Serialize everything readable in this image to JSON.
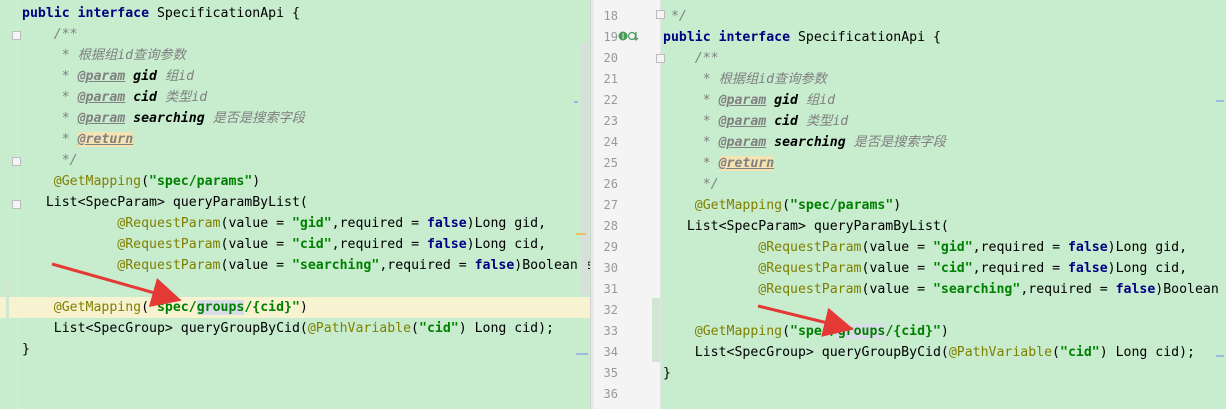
{
  "left": {
    "lines": [
      [
        [
          "kw",
          "public interface "
        ],
        [
          "",
          "SpecificationApi {"
        ]
      ],
      [
        [
          "cm",
          "    /**"
        ]
      ],
      [
        [
          "cm",
          "     * 根据组id查询参数"
        ]
      ],
      [
        [
          "cm",
          "     * "
        ],
        [
          "tag",
          "@param"
        ],
        [
          "cm",
          " "
        ],
        [
          "cmb",
          "gid"
        ],
        [
          "cm",
          " 组id"
        ]
      ],
      [
        [
          "cm",
          "     * "
        ],
        [
          "tag",
          "@param"
        ],
        [
          "cm",
          " "
        ],
        [
          "cmb",
          "cid"
        ],
        [
          "cm",
          " 类型id"
        ]
      ],
      [
        [
          "cm",
          "     * "
        ],
        [
          "tag",
          "@param"
        ],
        [
          "cm",
          " "
        ],
        [
          "cmb",
          "searching"
        ],
        [
          "cm",
          " 是否是搜索字段"
        ]
      ],
      [
        [
          "cm",
          "     * "
        ],
        [
          "ret",
          "@return"
        ]
      ],
      [
        [
          "cm",
          "     */"
        ]
      ],
      [
        [
          "ann",
          "    @GetMapping"
        ],
        [
          "",
          "("
        ],
        [
          "str",
          "\"spec/params\""
        ],
        [
          "",
          ")"
        ]
      ],
      [
        [
          "",
          "   List<SpecParam> queryParamByList("
        ]
      ],
      [
        [
          "ann",
          "            @RequestParam"
        ],
        [
          "",
          "(value = "
        ],
        [
          "str",
          "\"gid\""
        ],
        [
          "",
          ",required = "
        ],
        [
          "kw",
          "false"
        ],
        [
          "",
          ")Long gid,"
        ]
      ],
      [
        [
          "ann",
          "            @RequestParam"
        ],
        [
          "",
          "(value = "
        ],
        [
          "str",
          "\"cid\""
        ],
        [
          "",
          ",required = "
        ],
        [
          "kw",
          "false"
        ],
        [
          "",
          ")Long cid,"
        ]
      ],
      [
        [
          "ann",
          "            @RequestParam"
        ],
        [
          "",
          "(value = "
        ],
        [
          "str",
          "\"searching\""
        ],
        [
          "",
          ",required = "
        ],
        [
          "kw",
          "false"
        ],
        [
          "",
          ")Boolean s"
        ]
      ],
      [
        [
          "",
          ""
        ]
      ],
      [
        [
          "ann",
          "    @GetMapping"
        ],
        [
          "",
          "("
        ],
        [
          "str",
          "\"spec/"
        ],
        [
          "strhl",
          "groups"
        ],
        [
          "str",
          "/{cid}\""
        ],
        [
          "",
          ")"
        ]
      ],
      [
        [
          "",
          "    List<SpecGroup> queryGroupByCid("
        ],
        [
          "ann",
          "@PathVariable"
        ],
        [
          "",
          "("
        ],
        [
          "str",
          "\"cid\""
        ],
        [
          "",
          ") Long cid);"
        ]
      ],
      [
        [
          "",
          "}"
        ]
      ]
    ]
  },
  "right": {
    "line_numbers": [
      "18",
      "19",
      "20",
      "21",
      "22",
      "23",
      "24",
      "25",
      "26",
      "27",
      "28",
      "29",
      "30",
      "31",
      "32",
      "33",
      "34",
      "35",
      "36"
    ],
    "lines": [
      [
        [
          "cm",
          " */"
        ]
      ],
      [
        [
          "kw",
          "public interface "
        ],
        [
          "",
          "SpecificationApi {"
        ]
      ],
      [
        [
          "cm",
          "    /**"
        ]
      ],
      [
        [
          "cm",
          "     * 根据组id查询参数"
        ]
      ],
      [
        [
          "cm",
          "     * "
        ],
        [
          "tag",
          "@param"
        ],
        [
          "cm",
          " "
        ],
        [
          "cmb",
          "gid"
        ],
        [
          "cm",
          " 组id"
        ]
      ],
      [
        [
          "cm",
          "     * "
        ],
        [
          "tag",
          "@param"
        ],
        [
          "cm",
          " "
        ],
        [
          "cmb",
          "cid"
        ],
        [
          "cm",
          " 类型id"
        ]
      ],
      [
        [
          "cm",
          "     * "
        ],
        [
          "tag",
          "@param"
        ],
        [
          "cm",
          " "
        ],
        [
          "cmb",
          "searching"
        ],
        [
          "cm",
          " 是否是搜索字段"
        ]
      ],
      [
        [
          "cm",
          "     * "
        ],
        [
          "ret",
          "@return"
        ]
      ],
      [
        [
          "cm",
          "     */"
        ]
      ],
      [
        [
          "ann",
          "    @GetMapping"
        ],
        [
          "",
          "("
        ],
        [
          "str",
          "\"spec/params\""
        ],
        [
          "",
          ")"
        ]
      ],
      [
        [
          "",
          "   List<SpecParam> queryParamByList("
        ]
      ],
      [
        [
          "ann",
          "            @RequestParam"
        ],
        [
          "",
          "(value = "
        ],
        [
          "str",
          "\"gid\""
        ],
        [
          "",
          ",required = "
        ],
        [
          "kw",
          "false"
        ],
        [
          "",
          ")Long gid,"
        ]
      ],
      [
        [
          "ann",
          "            @RequestParam"
        ],
        [
          "",
          "(value = "
        ],
        [
          "str",
          "\"cid\""
        ],
        [
          "",
          ",required = "
        ],
        [
          "kw",
          "false"
        ],
        [
          "",
          ")Long cid,"
        ]
      ],
      [
        [
          "ann",
          "            @RequestParam"
        ],
        [
          "",
          "(value = "
        ],
        [
          "str",
          "\"searching\""
        ],
        [
          "",
          ",required = "
        ],
        [
          "kw",
          "false"
        ],
        [
          "",
          ")Boolean"
        ]
      ],
      [
        [
          "",
          ""
        ]
      ],
      [
        [
          "ann",
          "    @GetMapping"
        ],
        [
          "",
          "("
        ],
        [
          "str",
          "\"spec/"
        ],
        [
          "strhl",
          "groups"
        ],
        [
          "str",
          "/{cid}\""
        ],
        [
          "",
          ")"
        ]
      ],
      [
        [
          "",
          "    List<SpecGroup> queryGroupByCid("
        ],
        [
          "ann",
          "@PathVariable"
        ],
        [
          "",
          "("
        ],
        [
          "str",
          "\"cid\""
        ],
        [
          "",
          ") Long cid);"
        ]
      ],
      [
        [
          "",
          "}"
        ]
      ],
      [
        [
          "",
          ""
        ]
      ]
    ]
  },
  "colors": {
    "pane_bg": "#c7ecce",
    "keyword": "#000080",
    "string": "#008000",
    "annotation": "#808000",
    "comment": "#808080",
    "arrow": "#e53935"
  },
  "icons": [
    "implementation-gutter-icon",
    "fold-marker-icon"
  ]
}
